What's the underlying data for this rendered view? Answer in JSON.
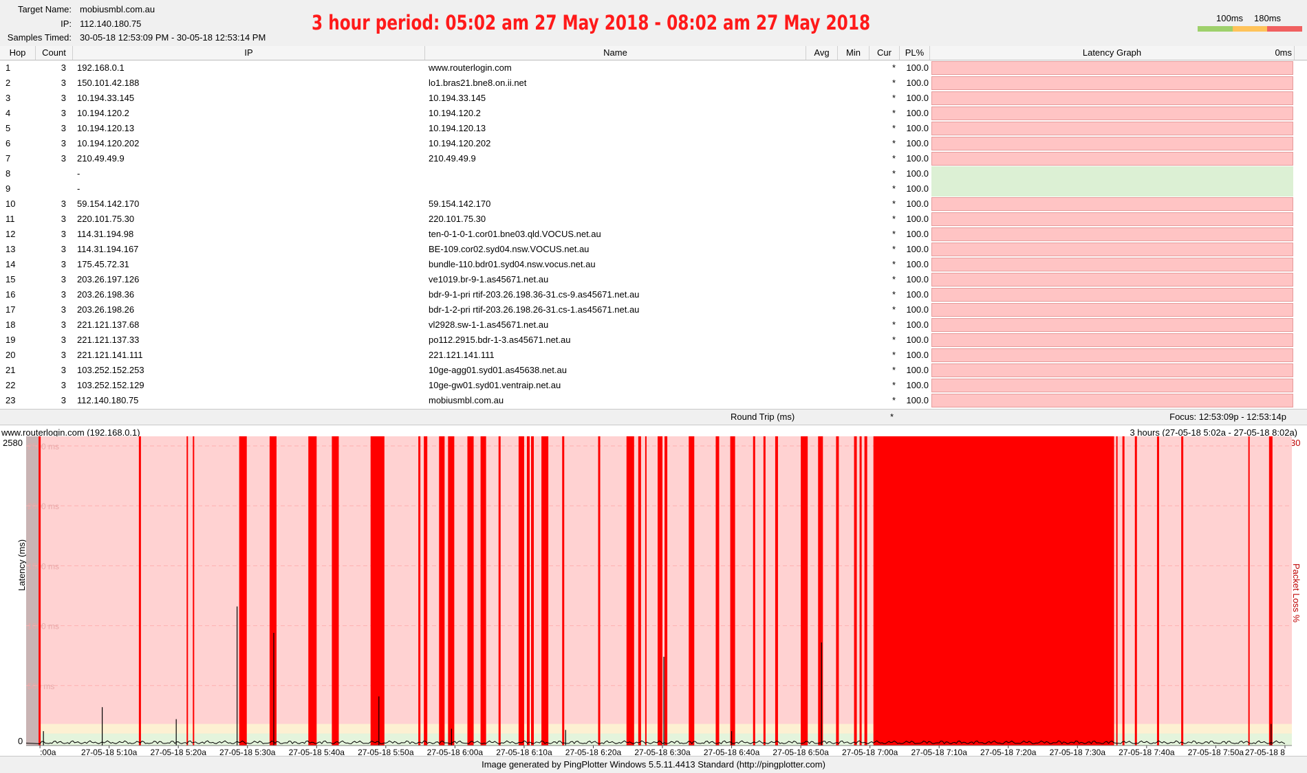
{
  "header": {
    "target_label": "Target Name:",
    "target_value": "mobiusmbl.com.au",
    "ip_label": "IP:",
    "ip_value": "112.140.180.75",
    "samples_label": "Samples Timed:",
    "samples_value": "30-05-18 12:53:09 PM - 30-05-18 12:53:14 PM",
    "period_title": "3 hour period:  05:02 am 27 May 2018 - 08:02 am 27 May 2018",
    "legend_100": "100ms",
    "legend_180": "180ms",
    "scale_colors": [
      "#9ed06b",
      "#ffc35a",
      "#f06060"
    ]
  },
  "columns": {
    "hop": "Hop",
    "count": "Count",
    "ip": "IP",
    "name": "Name",
    "avg": "Avg",
    "min": "Min",
    "cur": "Cur",
    "pl": "PL%",
    "graph": "Latency Graph",
    "graph_scale": "0ms"
  },
  "hops": [
    {
      "hop": "1",
      "count": "3",
      "ip": "192.168.0.1",
      "name": "www.routerlogin.com",
      "cur": "*",
      "pl": "100.0",
      "bar": "loss"
    },
    {
      "hop": "2",
      "count": "3",
      "ip": "150.101.42.188",
      "name": "lo1.bras21.bne8.on.ii.net",
      "cur": "*",
      "pl": "100.0",
      "bar": "loss"
    },
    {
      "hop": "3",
      "count": "3",
      "ip": "10.194.33.145",
      "name": "10.194.33.145",
      "cur": "*",
      "pl": "100.0",
      "bar": "loss"
    },
    {
      "hop": "4",
      "count": "3",
      "ip": "10.194.120.2",
      "name": "10.194.120.2",
      "cur": "*",
      "pl": "100.0",
      "bar": "loss"
    },
    {
      "hop": "5",
      "count": "3",
      "ip": "10.194.120.13",
      "name": "10.194.120.13",
      "cur": "*",
      "pl": "100.0",
      "bar": "loss"
    },
    {
      "hop": "6",
      "count": "3",
      "ip": "10.194.120.202",
      "name": "10.194.120.202",
      "cur": "*",
      "pl": "100.0",
      "bar": "loss"
    },
    {
      "hop": "7",
      "count": "3",
      "ip": "210.49.49.9",
      "name": "210.49.49.9",
      "cur": "*",
      "pl": "100.0",
      "bar": "loss"
    },
    {
      "hop": "8",
      "count": "",
      "ip": "-",
      "name": "",
      "cur": "*",
      "pl": "100.0",
      "bar": "none"
    },
    {
      "hop": "9",
      "count": "",
      "ip": "-",
      "name": "",
      "cur": "*",
      "pl": "100.0",
      "bar": "none"
    },
    {
      "hop": "10",
      "count": "3",
      "ip": "59.154.142.170",
      "name": "59.154.142.170",
      "cur": "*",
      "pl": "100.0",
      "bar": "loss"
    },
    {
      "hop": "11",
      "count": "3",
      "ip": "220.101.75.30",
      "name": "220.101.75.30",
      "cur": "*",
      "pl": "100.0",
      "bar": "loss"
    },
    {
      "hop": "12",
      "count": "3",
      "ip": "114.31.194.98",
      "name": "ten-0-1-0-1.cor01.bne03.qld.VOCUS.net.au",
      "cur": "*",
      "pl": "100.0",
      "bar": "loss"
    },
    {
      "hop": "13",
      "count": "3",
      "ip": "114.31.194.167",
      "name": "BE-109.cor02.syd04.nsw.VOCUS.net.au",
      "cur": "*",
      "pl": "100.0",
      "bar": "loss"
    },
    {
      "hop": "14",
      "count": "3",
      "ip": "175.45.72.31",
      "name": "bundle-110.bdr01.syd04.nsw.vocus.net.au",
      "cur": "*",
      "pl": "100.0",
      "bar": "loss"
    },
    {
      "hop": "15",
      "count": "3",
      "ip": "203.26.197.126",
      "name": "ve1019.br-9-1.as45671.net.au",
      "cur": "*",
      "pl": "100.0",
      "bar": "loss"
    },
    {
      "hop": "16",
      "count": "3",
      "ip": "203.26.198.36",
      "name": "bdr-9-1-pri rtif-203.26.198.36-31.cs-9.as45671.net.au",
      "cur": "*",
      "pl": "100.0",
      "bar": "loss"
    },
    {
      "hop": "17",
      "count": "3",
      "ip": "203.26.198.26",
      "name": "bdr-1-2-pri rtif-203.26.198.26-31.cs-1.as45671.net.au",
      "cur": "*",
      "pl": "100.0",
      "bar": "loss"
    },
    {
      "hop": "18",
      "count": "3",
      "ip": "221.121.137.68",
      "name": "vl2928.sw-1-1.as45671.net.au",
      "cur": "*",
      "pl": "100.0",
      "bar": "loss"
    },
    {
      "hop": "19",
      "count": "3",
      "ip": "221.121.137.33",
      "name": "po112.2915.bdr-1-3.as45671.net.au",
      "cur": "*",
      "pl": "100.0",
      "bar": "loss"
    },
    {
      "hop": "20",
      "count": "3",
      "ip": "221.121.141.111",
      "name": "221.121.141.111",
      "cur": "*",
      "pl": "100.0",
      "bar": "loss"
    },
    {
      "hop": "21",
      "count": "3",
      "ip": "103.252.152.253",
      "name": "10ge-agg01.syd01.as45638.net.au",
      "cur": "*",
      "pl": "100.0",
      "bar": "loss"
    },
    {
      "hop": "22",
      "count": "3",
      "ip": "103.252.152.129",
      "name": "10ge-gw01.syd01.ventraip.net.au",
      "cur": "*",
      "pl": "100.0",
      "bar": "loss"
    },
    {
      "hop": "23",
      "count": "3",
      "ip": "112.140.180.75",
      "name": "mobiusmbl.com.au",
      "cur": "*",
      "pl": "100.0",
      "bar": "loss"
    }
  ],
  "round_trip": {
    "label": "Round Trip (ms)",
    "cur": "*",
    "focus": "Focus: 12:53:09p - 12:53:14p"
  },
  "graph": {
    "title_left": "www.routerlogin.com (192.168.0.1)",
    "title_right": "3 hours (27-05-18 5:02a - 27-05-18 8:02a)",
    "y_max_label": "2580",
    "y_min_label": "0",
    "y_axis_label": "Latency (ms)",
    "pl_max_label": "30",
    "pl_axis_label": "Packet Loss %",
    "colors": {
      "background": "#ffd2d2",
      "loss": "#ff0000",
      "low_band": "#e4f4dc",
      "mid_band": "#fdf0d2",
      "trace": "#000000"
    }
  },
  "chart_data": {
    "type": "area",
    "title": "",
    "xlabel": "",
    "ylabel": "Latency (ms)",
    "y2label": "Packet Loss %",
    "ylim": [
      0,
      2580
    ],
    "y2lim": [
      0,
      30
    ],
    "y_ticks": [
      "2500 ms",
      "2000 ms",
      "1500 ms",
      "1000 ms",
      "500 ms"
    ],
    "y_tick_values": [
      2500,
      2000,
      1500,
      1000,
      500
    ],
    "x_tick_labels": [
      ":00a",
      "27-05-18 5:10a",
      "27-05-18 5:20a",
      "27-05-18 5:30a",
      "27-05-18 5:40a",
      "27-05-18 5:50a",
      "27-05-18 6:00a",
      "27-05-18 6:10a",
      "27-05-18 6:20a",
      "27-05-18 6:30a",
      "27-05-18 6:40a",
      "27-05-18 6:50a",
      "27-05-18 7:00a",
      "27-05-18 7:10a",
      "27-05-18 7:20a",
      "27-05-18 7:30a",
      "27-05-18 7:40a",
      "27-05-18 7:50a",
      "27-05-18 8"
    ],
    "x_tick_minutes": [
      0,
      10,
      20,
      30,
      40,
      50,
      60,
      70,
      80,
      90,
      100,
      110,
      120,
      130,
      140,
      150,
      160,
      170,
      180
    ],
    "xlim_minutes": [
      -2,
      181
    ],
    "loss_periods_minutes": [
      [
        -0.2,
        0.1
      ],
      [
        14.3,
        14.6
      ],
      [
        21.2,
        21.4
      ],
      [
        22.1,
        22.3
      ],
      [
        28.8,
        29.9
      ],
      [
        33.2,
        34.2
      ],
      [
        38.8,
        40.0
      ],
      [
        42.2,
        43.2
      ],
      [
        47.8,
        49.8
      ],
      [
        54.7,
        55.0
      ],
      [
        55.5,
        56.0
      ],
      [
        57.7,
        58.5
      ],
      [
        59.0,
        59.9
      ],
      [
        61.8,
        62.7
      ],
      [
        63.7,
        64.5
      ],
      [
        66.3,
        66.6
      ],
      [
        69.2,
        70.0
      ],
      [
        70.4,
        70.8
      ],
      [
        71.0,
        71.4
      ],
      [
        72.5,
        73.5
      ],
      [
        75.5,
        75.8
      ],
      [
        80.7,
        81.0
      ],
      [
        84.8,
        85.9
      ],
      [
        86.5,
        86.9
      ],
      [
        87.5,
        87.7
      ],
      [
        89.3,
        90.0
      ],
      [
        90.3,
        90.7
      ],
      [
        93.8,
        94.6
      ],
      [
        97.7,
        98.2
      ],
      [
        99.8,
        100.5
      ],
      [
        103.1,
        103.4
      ],
      [
        104.6,
        104.9
      ],
      [
        106.3,
        106.7
      ],
      [
        110.0,
        111.0
      ],
      [
        112.5,
        113.2
      ],
      [
        115.1,
        115.5
      ],
      [
        117.7,
        118.1
      ],
      [
        118.5,
        118.8
      ],
      [
        119.2,
        119.6
      ],
      [
        120.5,
        155.3
      ],
      [
        155.6,
        155.8
      ],
      [
        156.5,
        156.8
      ],
      [
        158.3,
        158.6
      ],
      [
        161.5,
        161.8
      ],
      [
        165.0,
        165.3
      ],
      [
        174.7,
        174.9
      ],
      [
        177.7,
        178.2
      ]
    ],
    "latency_spikes": [
      {
        "t": 28.5,
        "ms": 1160
      },
      {
        "t": 33.8,
        "ms": 940
      },
      {
        "t": 49.0,
        "ms": 410
      },
      {
        "t": 90.2,
        "ms": 740
      },
      {
        "t": 113.0,
        "ms": 860
      },
      {
        "t": 9.0,
        "ms": 320
      },
      {
        "t": 19.7,
        "ms": 220
      },
      {
        "t": 0.5,
        "ms": 120
      },
      {
        "t": 178.0,
        "ms": 180
      },
      {
        "t": 59.5,
        "ms": 140
      },
      {
        "t": 76.0,
        "ms": 130
      },
      {
        "t": 100.0,
        "ms": 120
      }
    ]
  },
  "footer": {
    "text": "Image generated by PingPlotter Windows 5.5.11.4413 Standard (http://pingplotter.com)"
  }
}
